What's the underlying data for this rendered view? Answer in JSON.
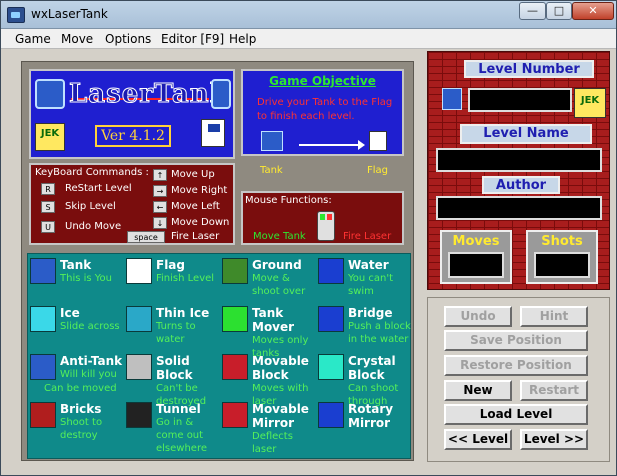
{
  "window": {
    "title": "wxLaserTank"
  },
  "menu": [
    "Game",
    "Move",
    "Options",
    "Editor [F9]",
    "Help"
  ],
  "logo": {
    "title": "LaserTank",
    "version": "Ver 4.1.2",
    "publisher": "JEK"
  },
  "objective": {
    "title": "Game Objective",
    "text": "Drive your Tank to the Flag to finish each level.",
    "tank_label": "Tank",
    "flag_label": "Flag"
  },
  "keyboard": {
    "title": "KeyBoard Commands :",
    "commands": [
      {
        "key": "R",
        "label": "ReStart Level"
      },
      {
        "key": "S",
        "label": "Skip  Level"
      },
      {
        "key": "U",
        "label": "Undo Move"
      }
    ],
    "moves": [
      {
        "key": "↑",
        "label": "Move Up"
      },
      {
        "key": "→",
        "label": "Move Right"
      },
      {
        "key": "←",
        "label": "Move Left"
      },
      {
        "key": "↓",
        "label": "Move Down"
      },
      {
        "key": "space",
        "label": "Fire Laser"
      }
    ]
  },
  "mouse": {
    "title": "Mouse Functions:",
    "move": "Move Tank",
    "fire": "Fire Laser"
  },
  "legend": [
    {
      "name": "Tank",
      "desc": "This is You",
      "icon": "tank-icon",
      "color": "#2b5cc8"
    },
    {
      "name": "Flag",
      "desc": "Finish Level",
      "icon": "flag-icon",
      "color": "#ffffff"
    },
    {
      "name": "Ground",
      "desc": "Move & shoot over",
      "icon": "ground-icon",
      "color": "#3f8a2a"
    },
    {
      "name": "Water",
      "desc": "You can't swim",
      "icon": "water-icon",
      "color": "#1a3ed0"
    },
    {
      "name": "Ice",
      "desc": "Slide across",
      "icon": "ice-icon",
      "color": "#3ad8e8"
    },
    {
      "name": "Thin Ice",
      "desc": "Turns to water",
      "icon": "thin-ice-icon",
      "color": "#2aa8c8"
    },
    {
      "name": "Tank Mover",
      "desc": "Moves only tanks",
      "icon": "tank-mover-icon",
      "color": "#2ce030"
    },
    {
      "name": "Bridge",
      "desc": "Push a block in the water",
      "icon": "bridge-icon",
      "color": "#1a3ed0"
    },
    {
      "name": "Anti-Tank",
      "desc": "Will kill you",
      "desc2": "Can be moved",
      "icon": "anti-tank-icon",
      "color": "#2b5cc8"
    },
    {
      "name": "Solid Block",
      "desc": "Can't be destroyed",
      "icon": "solid-block-icon",
      "color": "#bfbfbf"
    },
    {
      "name": "Movable Block",
      "desc": "Moves with laser",
      "icon": "movable-block-icon",
      "color": "#c81e2a"
    },
    {
      "name": "Crystal Block",
      "desc": "Can shoot through",
      "icon": "crystal-block-icon",
      "color": "#2ae8c8"
    },
    {
      "name": "Bricks",
      "desc": "Shoot to destroy",
      "icon": "bricks-icon",
      "color": "#b01e1e"
    },
    {
      "name": "Tunnel",
      "desc": "Go in & come out elsewhere",
      "icon": "tunnel-icon",
      "color": "#222222"
    },
    {
      "name": "Movable Mirror",
      "desc": "Deflects laser",
      "icon": "movable-mirror-icon",
      "color": "#c81e2a"
    },
    {
      "name": "Rotary Mirror",
      "desc": "",
      "icon": "rotary-mirror-icon",
      "color": "#1a3ed0"
    }
  ],
  "info": {
    "level_number_label": "Level Number",
    "level_name_label": "Level Name",
    "author_label": "Author",
    "moves_label": "Moves",
    "shots_label": "Shots"
  },
  "buttons": {
    "undo": "Undo",
    "hint": "Hint",
    "save": "Save Position",
    "restore": "Restore Position",
    "new": "New",
    "restart": "Restart",
    "load": "Load Level",
    "prev": "<< Level",
    "next": "Level >>"
  }
}
